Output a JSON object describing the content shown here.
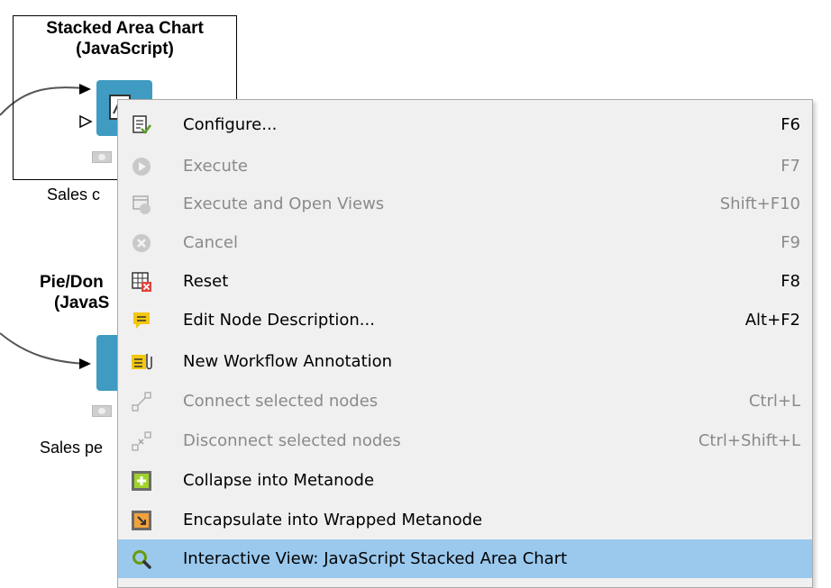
{
  "workflow": {
    "node1": {
      "title_line1": "Stacked Area Chart",
      "title_line2": "(JavaScript)",
      "label": "Sales c"
    },
    "node2": {
      "title_line1": "Pie/Don",
      "title_line2": "(JavaS",
      "label": "Sales pe"
    }
  },
  "context_menu": {
    "items": [
      {
        "label": "Configure...",
        "shortcut": "F6",
        "enabled": true,
        "icon": "configure-icon"
      },
      {
        "label": "Execute",
        "shortcut": "F7",
        "enabled": false,
        "icon": "execute-icon"
      },
      {
        "label": "Execute and Open Views",
        "shortcut": "Shift+F10",
        "enabled": false,
        "icon": "execute-open-views-icon"
      },
      {
        "label": "Cancel",
        "shortcut": "F9",
        "enabled": false,
        "icon": "cancel-icon"
      },
      {
        "label": "Reset",
        "shortcut": "F8",
        "enabled": true,
        "icon": "reset-icon"
      },
      {
        "label": "Edit Node Description...",
        "shortcut": "Alt+F2",
        "enabled": true,
        "icon": "edit-description-icon"
      },
      {
        "label": "New Workflow Annotation",
        "shortcut": "",
        "enabled": true,
        "icon": "annotation-icon"
      },
      {
        "label": "Connect selected nodes",
        "shortcut": "Ctrl+L",
        "enabled": false,
        "icon": "connect-nodes-icon"
      },
      {
        "label": "Disconnect selected nodes",
        "shortcut": "Ctrl+Shift+L",
        "enabled": false,
        "icon": "disconnect-nodes-icon"
      },
      {
        "label": "Collapse into Metanode",
        "shortcut": "",
        "enabled": true,
        "icon": "collapse-metanode-icon"
      },
      {
        "label": "Encapsulate into Wrapped Metanode",
        "shortcut": "",
        "enabled": true,
        "icon": "wrapped-metanode-icon"
      },
      {
        "label": "Interactive View: JavaScript Stacked Area Chart",
        "shortcut": "",
        "enabled": true,
        "highlighted": true,
        "icon": "interactive-view-icon"
      }
    ]
  },
  "colors": {
    "node_icon": "#3f9bc1",
    "menu_background": "#f0f0f0",
    "highlight": "#9bc9ee",
    "disabled_text": "#8a8a8a"
  }
}
